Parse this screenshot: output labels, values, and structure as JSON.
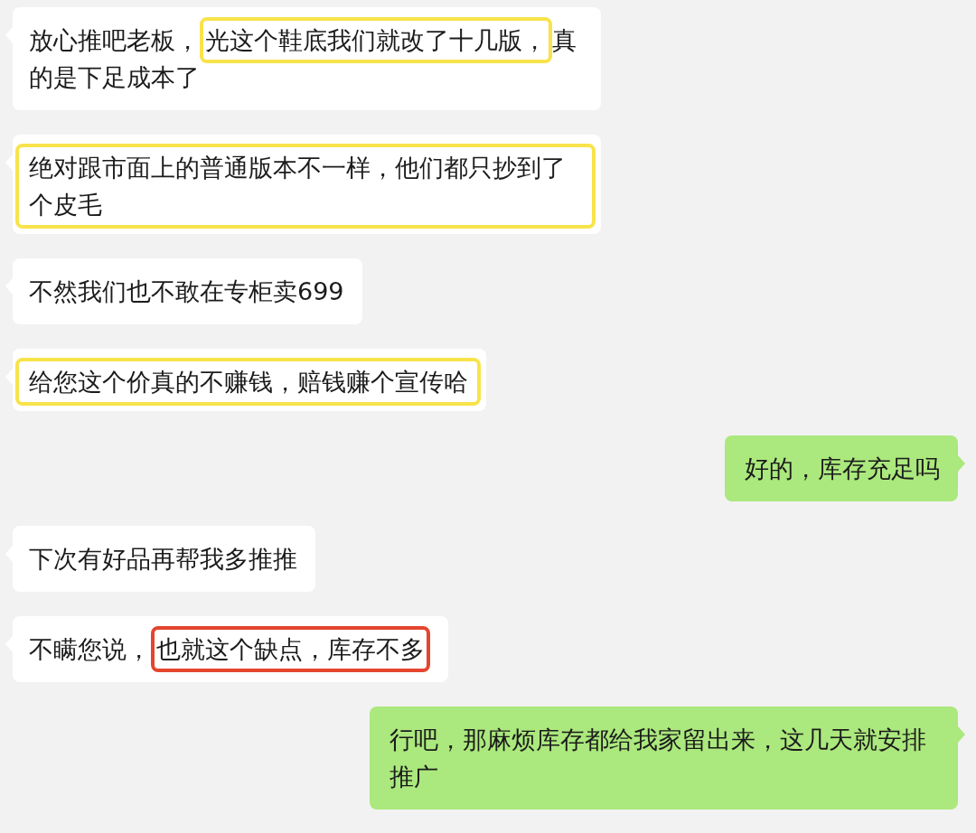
{
  "messages": [
    {
      "kind": "received",
      "parts": [
        {
          "text": "放心推吧老板，",
          "boxed": false
        },
        {
          "text": "光这个鞋底我们就改了十几版，",
          "boxed": true,
          "color": "#f8e34b"
        },
        {
          "text": "真的是下足成本了",
          "boxed": false
        }
      ]
    },
    {
      "kind": "received",
      "parts": [
        {
          "text": "绝对跟市面上的普通版本不一样，他们都只抄到了个皮毛",
          "boxed": true,
          "color": "#f8e34b"
        }
      ]
    },
    {
      "kind": "received",
      "parts": [
        {
          "text": "不然我们也不敢在专柜卖699",
          "boxed": false
        }
      ]
    },
    {
      "kind": "received",
      "parts": [
        {
          "text": "给您这个价真的不赚钱，赔钱赚个宣传哈",
          "boxed": true,
          "color": "#f8e34b"
        }
      ]
    },
    {
      "kind": "sent",
      "parts": [
        {
          "text": "好的，库存充足吗",
          "boxed": false
        }
      ]
    },
    {
      "kind": "received",
      "parts": [
        {
          "text": "下次有好品再帮我多推推",
          "boxed": false
        }
      ]
    },
    {
      "kind": "received",
      "parts": [
        {
          "text": "不瞒您说，",
          "boxed": false
        },
        {
          "text": "也就这个缺点，库存不多",
          "boxed": true,
          "color": "#e5452e"
        }
      ]
    },
    {
      "kind": "sent",
      "parts": [
        {
          "text": "行吧，那麻烦库存都给我家留出来，这几天就安排推广",
          "boxed": false
        }
      ]
    }
  ]
}
